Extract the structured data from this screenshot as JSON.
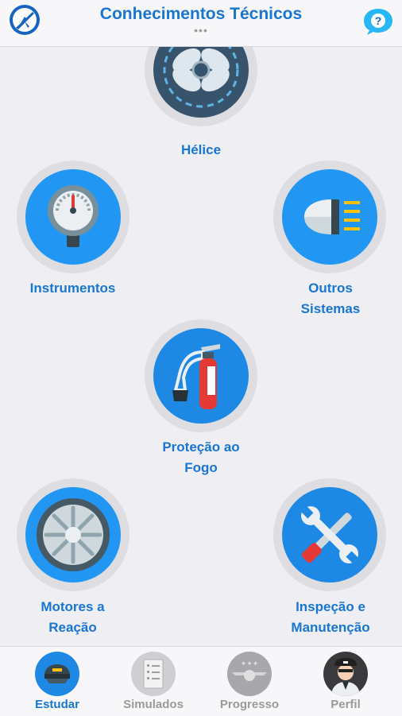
{
  "header": {
    "title": "Conhecimentos Técnicos",
    "more": "•••",
    "logo_icon": "airplane-logo-icon",
    "help_icon": "question-chat-icon",
    "help_symbol": "?"
  },
  "topics": [
    {
      "label": "Hélice",
      "icon": "propeller-icon"
    },
    {
      "label": "Instrumentos",
      "icon": "gauge-icon"
    },
    {
      "label": "Outros Sistemas",
      "icon": "headlight-icon"
    },
    {
      "label": "Proteção ao Fogo",
      "icon": "fire-extinguisher-icon"
    },
    {
      "label": "Motores a Reação",
      "icon": "jet-engine-icon"
    },
    {
      "label": "Inspeção e Manutenção",
      "icon": "tools-icon"
    }
  ],
  "tabs": [
    {
      "label": "Estudar",
      "icon": "pilot-cap-icon",
      "active": true
    },
    {
      "label": "Simulados",
      "icon": "checklist-icon",
      "active": false
    },
    {
      "label": "Progresso",
      "icon": "wings-badge-icon",
      "active": false
    },
    {
      "label": "Perfil",
      "icon": "pilot-avatar-icon",
      "active": false
    }
  ],
  "colors": {
    "accent": "#1976d2",
    "icon_blue": "#2196f3",
    "inactive": "#9a9a9a",
    "background": "#efeff3"
  }
}
